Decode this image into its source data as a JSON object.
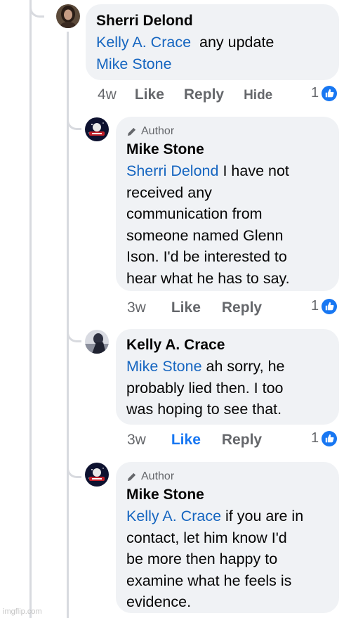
{
  "comments": [
    {
      "author": "Sherri Delond",
      "is_author_badge": false,
      "mention": "Kelly A. Crace",
      "text_after_mention": "any update",
      "line2_mention": "Mike Stone",
      "meta": {
        "time": "4w",
        "like": "Like",
        "reply": "Reply",
        "hide": "Hide",
        "reactions": "1"
      }
    },
    {
      "badge_label": "Author",
      "author": "Mike Stone",
      "mention": "Sherri Delond",
      "body_lines": [
        "I have not",
        "received any",
        "communication from",
        "someone named Glenn",
        "Ison. I'd be interested to",
        "hear what he has to say."
      ],
      "meta": {
        "time": "3w",
        "like": "Like",
        "reply": "Reply",
        "reactions": "1"
      }
    },
    {
      "author": "Kelly A. Crace",
      "mention": "Mike Stone",
      "body_lines": [
        "ah sorry, he",
        "probably lied then. I too",
        "was hoping to see that."
      ],
      "meta": {
        "time": "3w",
        "like": "Like",
        "reply": "Reply",
        "reactions": "1"
      }
    },
    {
      "badge_label": "Author",
      "author": "Mike Stone",
      "mention": "Kelly A. Crace",
      "body_lines": [
        "if you are in",
        "contact, let him know I'd",
        "be more then happy to",
        "examine what he feels is",
        "evidence."
      ]
    }
  ],
  "watermark": "imgflip.com",
  "colors": {
    "mention": "#1565c0",
    "like_active": "#1877f2",
    "bubble": "#f0f2f5",
    "meta": "#65676b"
  }
}
